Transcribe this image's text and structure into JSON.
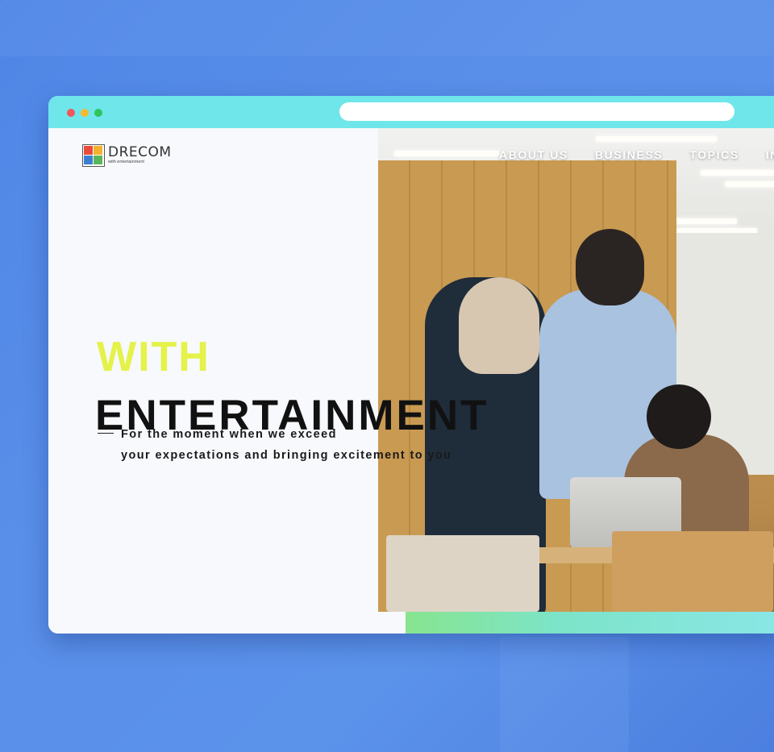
{
  "logo": {
    "name": "DRECOM",
    "sub": "with entertainment"
  },
  "nav": {
    "items": [
      "ABOUT US",
      "BUSINESS",
      "TOPICS",
      "INV"
    ]
  },
  "hero": {
    "line1": "WITH",
    "line2": "ENTERTAINMENT",
    "tagline_line1": "For the moment when we exceed",
    "tagline_line2": "your expectations and bringing excitement to you"
  },
  "colors": {
    "chrome": "#6fe6ea",
    "accent_yellow": "#e4f24a",
    "background_blue": "#5a8fe9",
    "strip_green": "#88e48f"
  }
}
